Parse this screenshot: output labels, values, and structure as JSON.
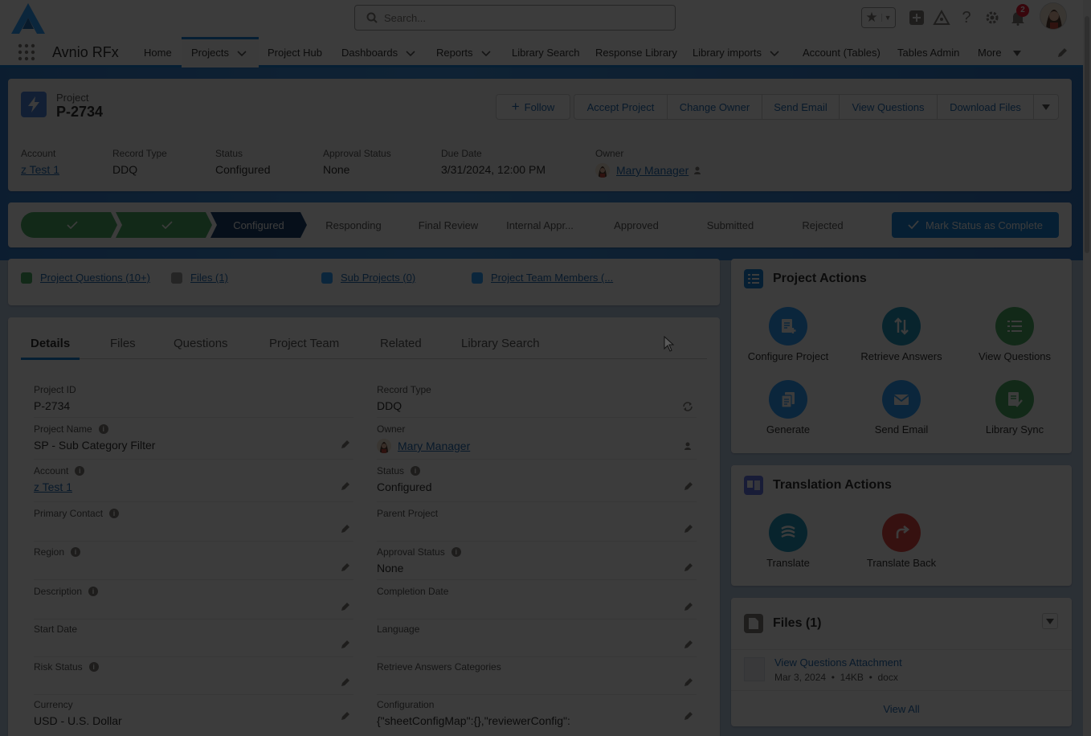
{
  "app": {
    "name": "Avnio RFx"
  },
  "search": {
    "placeholder": "Search..."
  },
  "notifications": {
    "count": "2"
  },
  "nav": {
    "items": [
      {
        "label": "Home"
      },
      {
        "label": "Projects"
      },
      {
        "label": "Project Hub"
      },
      {
        "label": "Dashboards"
      },
      {
        "label": "Reports"
      },
      {
        "label": "Library Search"
      },
      {
        "label": "Response Library"
      },
      {
        "label": "Library imports"
      },
      {
        "label": "Account (Tables)"
      },
      {
        "label": "Tables Admin"
      },
      {
        "label": "More"
      }
    ]
  },
  "record": {
    "object_type": "Project",
    "name": "P-2734",
    "buttons": {
      "follow": "Follow",
      "accept": "Accept Project",
      "change_owner": "Change Owner",
      "send_email": "Send Email",
      "view_questions": "View Questions",
      "download_files": "Download Files"
    },
    "highlights": [
      {
        "label": "Account",
        "value": "z Test 1"
      },
      {
        "label": "Record Type",
        "value": "DDQ"
      },
      {
        "label": "Status",
        "value": "Configured"
      },
      {
        "label": "Approval Status",
        "value": "None"
      },
      {
        "label": "Due Date",
        "value": "3/31/2024, 12:00 PM"
      },
      {
        "label": "Owner",
        "value": "Mary Manager"
      }
    ]
  },
  "path": {
    "current": "Configured",
    "steps": [
      "Responding",
      "Final Review",
      "Internal Appr...",
      "Approved",
      "Submitted",
      "Rejected"
    ],
    "mark_label": "Mark Status as Complete"
  },
  "related_links": [
    {
      "label": "Project Questions (10+)",
      "color": "#3ba755"
    },
    {
      "label": "Files (1)",
      "color": "#939393"
    },
    {
      "label": "Sub Projects (0)",
      "color": "#1b96ff"
    },
    {
      "label": "Project Team Members (...",
      "color": "#1b96ff"
    }
  ],
  "tabs": [
    "Details",
    "Files",
    "Questions",
    "Project Team",
    "Related",
    "Library Search"
  ],
  "details": {
    "left": [
      {
        "label": "Project ID",
        "value": "P-2734"
      },
      {
        "label": "Project Name",
        "value": "SP - Sub Category Filter"
      },
      {
        "label": "Account",
        "value": "z Test 1"
      },
      {
        "label": "Primary Contact",
        "value": ""
      },
      {
        "label": "Region",
        "value": ""
      },
      {
        "label": "Description",
        "value": ""
      },
      {
        "label": "Start Date",
        "value": ""
      },
      {
        "label": "Risk Status",
        "value": ""
      },
      {
        "label": "Currency",
        "value": "USD - U.S. Dollar"
      }
    ],
    "right": [
      {
        "label": "Record Type",
        "value": "DDQ"
      },
      {
        "label": "Owner",
        "value": "Mary Manager"
      },
      {
        "label": "Status",
        "value": "Configured"
      },
      {
        "label": "Parent Project",
        "value": ""
      },
      {
        "label": "Approval Status",
        "value": "None"
      },
      {
        "label": "Completion Date",
        "value": ""
      },
      {
        "label": "Language",
        "value": ""
      },
      {
        "label": "Retrieve Answers Categories",
        "value": ""
      },
      {
        "label": "Configuration",
        "value": "{\"sheetConfigMap\":{},\"reviewerConfig\":"
      }
    ]
  },
  "project_actions": {
    "title": "Project Actions",
    "items": [
      {
        "label": "Configure Project",
        "icon": "configure-icon",
        "color": "#1b96ff"
      },
      {
        "label": "Retrieve Answers",
        "icon": "sort-icon",
        "color": "#0c8eba"
      },
      {
        "label": "View Questions",
        "icon": "list-icon",
        "color": "#3ba755"
      },
      {
        "label": "Generate",
        "icon": "copy-icon",
        "color": "#1b96ff"
      },
      {
        "label": "Send Email",
        "icon": "email-icon",
        "color": "#1b96ff"
      },
      {
        "label": "Library Sync",
        "icon": "sync-doc-icon",
        "color": "#3ba755"
      }
    ]
  },
  "translation_actions": {
    "title": "Translation Actions",
    "items": [
      {
        "label": "Translate",
        "icon": "translate-icon",
        "color": "#0c8eba"
      },
      {
        "label": "Translate Back",
        "icon": "redo-icon",
        "color": "#e3342f"
      }
    ]
  },
  "files_card": {
    "title": "Files (1)",
    "file_name": "View Questions Attachment",
    "file_meta": "Mar 3, 2024  •  14KB  •  docx",
    "view_all": "View All"
  }
}
